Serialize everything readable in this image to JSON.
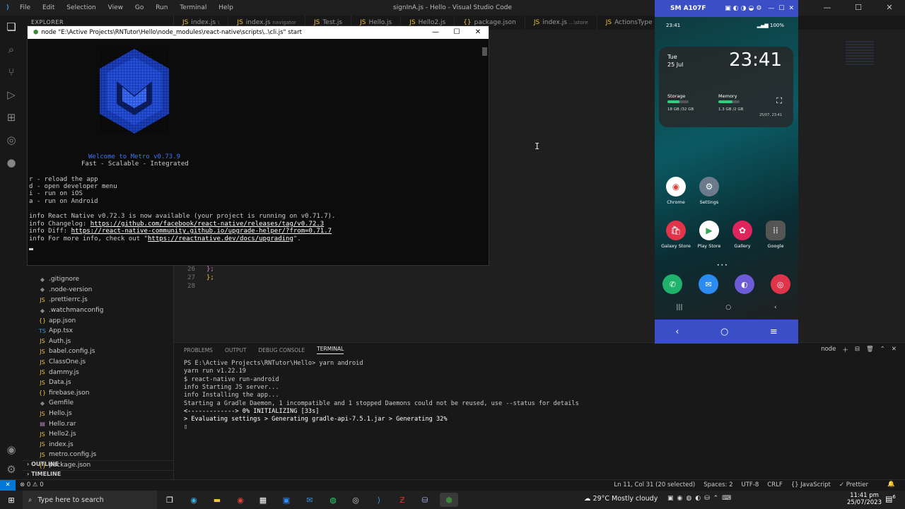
{
  "vscode": {
    "title": "signInA.js - Hello - Visual Studio Code",
    "menu": [
      "File",
      "Edit",
      "Selection",
      "View",
      "Go",
      "Run",
      "Terminal",
      "Help"
    ],
    "tabs": [
      {
        "label": "index.js",
        "sub": "\\"
      },
      {
        "label": "index.js",
        "sub": "navigator"
      },
      {
        "label": "Test.js",
        "sub": ""
      },
      {
        "label": "Hello.js",
        "sub": ""
      },
      {
        "label": "Hello2.js",
        "sub": ""
      },
      {
        "label": "package.json",
        "sub": ""
      },
      {
        "label": "index.js",
        "sub": "...\\store"
      },
      {
        "label": "ActionsType",
        "sub": ""
      }
    ],
    "explorer_label": "EXPLORER",
    "files": [
      ".gitignore",
      ".node-version",
      ".prettierrc.js",
      ".watchmanconfig",
      "app.json",
      "App.tsx",
      "Auth.js",
      "babel.config.js",
      "ClassOne.js",
      "dammy.js",
      "Data.js",
      "firebase.json",
      "Gemfile",
      "Hello.js",
      "Hello.rar",
      "Hello2.js",
      "index.js",
      "metro.config.js",
      "package.json"
    ],
    "sections": [
      "OUTLINE",
      "TIMELINE"
    ],
    "code_lines": [
      {
        "n": "26",
        "t": "    };"
      },
      {
        "n": "27",
        "t": "  };"
      },
      {
        "n": "28",
        "t": ""
      }
    ],
    "panel_tabs": [
      "PROBLEMS",
      "OUTPUT",
      "DEBUG CONSOLE",
      "TERMINAL"
    ],
    "panel_right": "node",
    "terminal": [
      "PS E:\\Active Projects\\RNTutor\\Hello> yarn android",
      "yarn run v1.22.19",
      "$ react-native run-android",
      "info Starting JS server...",
      "info Installing the app...",
      "Starting a Gradle Daemon, 1 incompatible and 1 stopped Daemons could not be reused, use --status for details",
      "<-------------> 0% INITIALIZING [33s]",
      "> Evaluating settings > Generating gradle-api-7.5.1.jar > Generating 32%"
    ],
    "status_left": "⊗ 0 ⚠ 0",
    "status_right": [
      "Ln 11, Col 31 (20 selected)",
      "Spaces: 2",
      "UTF-8",
      "CRLF",
      "{} JavaScript",
      "✓ Prettier"
    ]
  },
  "console": {
    "title": "node  \"E:\\Active Projects\\RNTutor\\Hello\\node_modules\\react-native\\scripts\\..\\cli.js\" start",
    "welcome": "Welcome to Metro v0.73.9",
    "tagline": "Fast - Scalable - Integrated",
    "commands": [
      "r - reload the app",
      "d - open developer menu",
      "i - run on iOS",
      "a - run on Android"
    ],
    "info1": "info React Native v0.72.3 is now available (your project is running on v0.71.7).",
    "info2_prefix": "info Changelog: ",
    "info2_link": "https://github.com/facebook/react-native/releases/tag/v0.72.3",
    "info3_prefix": "info Diff: ",
    "info3_link": "https://react-native-community.github.io/upgrade-helper/?from=0.71.7",
    "info4_prefix": "info For more info, check out \"",
    "info4_link": "https://reactnative.dev/docs/upgrading",
    "info4_suffix": "\"."
  },
  "phone": {
    "device": "SM A107F",
    "status_time": "23:41",
    "battery": "100%",
    "widget_day": "Tue",
    "widget_date": "25 Jul",
    "widget_time": "23:41",
    "storage_label": "Storage",
    "storage_value": "18 GB /32 GB",
    "memory_label": "Memory",
    "memory_value": "1.3 GB /2 GB",
    "widget_stamp": "25/07, 23:41",
    "apps": [
      {
        "label": "Chrome",
        "color": "#ffffff"
      },
      {
        "label": "Settings",
        "color": "#6b7b8c"
      },
      {
        "label": "Galaxy Store",
        "color": "#e0344b"
      },
      {
        "label": "Play Store",
        "color": "#ffffff"
      },
      {
        "label": "Gallery",
        "color": "#e0245e"
      },
      {
        "label": "Google",
        "color": "#555555"
      }
    ]
  },
  "taskbar": {
    "search_placeholder": "Type here to search",
    "weather": "29°C  Mostly cloudy",
    "clock_time": "11:41 pm",
    "clock_date": "25/07/2023",
    "notif_count": "6"
  }
}
